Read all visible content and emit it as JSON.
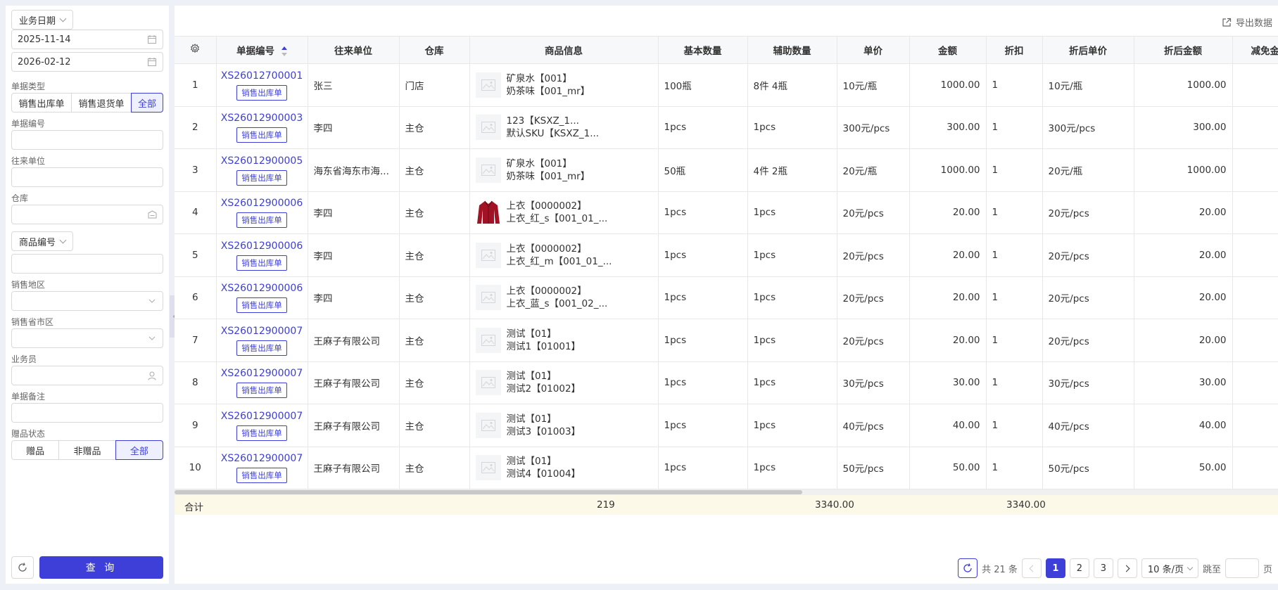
{
  "filters": {
    "date_type_label": "业务日期",
    "start_date": "2025-11-14",
    "end_date": "2026-02-12",
    "doc_type_label": "单据类型",
    "doc_types": [
      "销售出库单",
      "销售退货单",
      "全部"
    ],
    "doc_no_label": "单据编号",
    "partner_label": "往来单位",
    "warehouse_label": "仓库",
    "product_code_select": "商品编号",
    "region_label": "销售地区",
    "province_label": "销售省市区",
    "salesperson_label": "业务员",
    "remark_label": "单据备注",
    "gift_label": "赠品状态",
    "gift_options": [
      "赠品",
      "非赠品",
      "全部"
    ],
    "query_label": "查 询"
  },
  "toolbar": {
    "export_label": "导出数据"
  },
  "table": {
    "headers": {
      "doc_no": "单据编号",
      "partner": "往来单位",
      "warehouse": "仓库",
      "product": "商品信息",
      "base_qty": "基本数量",
      "aux_qty": "辅助数量",
      "unit_price": "单价",
      "amount": "金额",
      "discount": "折扣",
      "disc_price": "折后单价",
      "disc_amount": "折后金额",
      "reduce": "减免金"
    },
    "rows": [
      {
        "idx": "1",
        "doc_no": "XS26012700001",
        "doc_tag": "销售出库单",
        "partner": "张三",
        "warehouse": "门店",
        "prod1": "矿泉水【001】",
        "prod2": "奶茶味【001_mr】",
        "base_qty": "100瓶",
        "aux_qty": "8件 4瓶",
        "unit_price": "10元/瓶",
        "amount": "1000.00",
        "discount": "1",
        "disc_price": "10元/瓶",
        "disc_amount": "1000.00"
      },
      {
        "idx": "2",
        "doc_no": "XS26012900003",
        "doc_tag": "销售出库单",
        "partner": "李四",
        "warehouse": "主仓",
        "prod1": "123【KSXZ_1...",
        "prod2": "默认SKU【KSXZ_1...",
        "base_qty": "1pcs",
        "aux_qty": "1pcs",
        "unit_price": "300元/pcs",
        "amount": "300.00",
        "discount": "1",
        "disc_price": "300元/pcs",
        "disc_amount": "300.00"
      },
      {
        "idx": "3",
        "doc_no": "XS26012900005",
        "doc_tag": "销售出库单",
        "partner": "海东省海东市海...",
        "warehouse": "主仓",
        "prod1": "矿泉水【001】",
        "prod2": "奶茶味【001_mr】",
        "base_qty": "50瓶",
        "aux_qty": "4件 2瓶",
        "unit_price": "20元/瓶",
        "amount": "1000.00",
        "discount": "1",
        "disc_price": "20元/瓶",
        "disc_amount": "1000.00"
      },
      {
        "idx": "4",
        "doc_no": "XS26012900006",
        "doc_tag": "销售出库单",
        "partner": "李四",
        "warehouse": "主仓",
        "prod1": "上衣【0000002】",
        "prod2": "上衣_红_s【001_01_...",
        "base_qty": "1pcs",
        "aux_qty": "1pcs",
        "unit_price": "20元/pcs",
        "amount": "20.00",
        "discount": "1",
        "disc_price": "20元/pcs",
        "disc_amount": "20.00",
        "has_image": true
      },
      {
        "idx": "5",
        "doc_no": "XS26012900006",
        "doc_tag": "销售出库单",
        "partner": "李四",
        "warehouse": "主仓",
        "prod1": "上衣【0000002】",
        "prod2": "上衣_红_m【001_01_...",
        "base_qty": "1pcs",
        "aux_qty": "1pcs",
        "unit_price": "20元/pcs",
        "amount": "20.00",
        "discount": "1",
        "disc_price": "20元/pcs",
        "disc_amount": "20.00"
      },
      {
        "idx": "6",
        "doc_no": "XS26012900006",
        "doc_tag": "销售出库单",
        "partner": "李四",
        "warehouse": "主仓",
        "prod1": "上衣【0000002】",
        "prod2": "上衣_蓝_s【001_02_...",
        "base_qty": "1pcs",
        "aux_qty": "1pcs",
        "unit_price": "20元/pcs",
        "amount": "20.00",
        "discount": "1",
        "disc_price": "20元/pcs",
        "disc_amount": "20.00"
      },
      {
        "idx": "7",
        "doc_no": "XS26012900007",
        "doc_tag": "销售出库单",
        "partner": "王麻子有限公司",
        "warehouse": "主仓",
        "prod1": "测试【01】",
        "prod2": "测试1【01001】",
        "base_qty": "1pcs",
        "aux_qty": "1pcs",
        "unit_price": "20元/pcs",
        "amount": "20.00",
        "discount": "1",
        "disc_price": "20元/pcs",
        "disc_amount": "20.00"
      },
      {
        "idx": "8",
        "doc_no": "XS26012900007",
        "doc_tag": "销售出库单",
        "partner": "王麻子有限公司",
        "warehouse": "主仓",
        "prod1": "测试【01】",
        "prod2": "测试2【01002】",
        "base_qty": "1pcs",
        "aux_qty": "1pcs",
        "unit_price": "30元/pcs",
        "amount": "30.00",
        "discount": "1",
        "disc_price": "30元/pcs",
        "disc_amount": "30.00"
      },
      {
        "idx": "9",
        "doc_no": "XS26012900007",
        "doc_tag": "销售出库单",
        "partner": "王麻子有限公司",
        "warehouse": "主仓",
        "prod1": "测试【01】",
        "prod2": "测试3【01003】",
        "base_qty": "1pcs",
        "aux_qty": "1pcs",
        "unit_price": "40元/pcs",
        "amount": "40.00",
        "discount": "1",
        "disc_price": "40元/pcs",
        "disc_amount": "40.00"
      },
      {
        "idx": "10",
        "doc_no": "XS26012900007",
        "doc_tag": "销售出库单",
        "partner": "王麻子有限公司",
        "warehouse": "主仓",
        "prod1": "测试【01】",
        "prod2": "测试4【01004】",
        "base_qty": "1pcs",
        "aux_qty": "1pcs",
        "unit_price": "50元/pcs",
        "amount": "50.00",
        "discount": "1",
        "disc_price": "50元/pcs",
        "disc_amount": "50.00"
      }
    ],
    "totals": {
      "label": "合计",
      "base_qty": "219",
      "amount": "3340.00",
      "disc_amount": "3340.00"
    }
  },
  "pagination": {
    "total_text": "共 21 条",
    "pages": [
      "1",
      "2",
      "3"
    ],
    "current": "1",
    "page_size": "10 条/页",
    "jump_label": "跳至",
    "page_suffix": "页"
  },
  "colors": {
    "accent": "#3d3fd8",
    "total_bg": "#fdf9e8",
    "header_bg": "#f7f8fa"
  },
  "icons": [
    "calendar-icon",
    "warehouse-icon",
    "chevron-down-icon",
    "user-icon",
    "refresh-icon",
    "export-icon",
    "settings-icon",
    "image-placeholder-icon",
    "sort-icon"
  ]
}
